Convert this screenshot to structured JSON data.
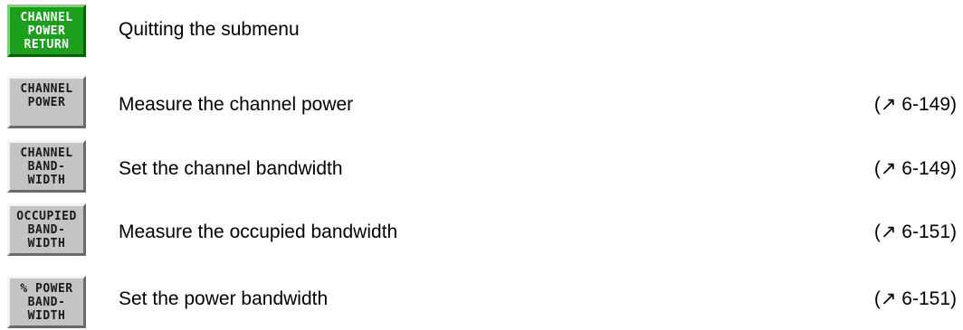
{
  "softkeys": [
    {
      "lines": [
        "CHANNEL",
        "POWER",
        "RETURN"
      ],
      "style": "green",
      "description": "Quitting the submenu",
      "reference": ""
    },
    {
      "lines": [
        "CHANNEL",
        "POWER",
        ""
      ],
      "style": "grey",
      "description": "Measure the channel power",
      "reference": "(↗ 6-149)"
    },
    {
      "lines": [
        "CHANNEL",
        "BAND-",
        "WIDTH"
      ],
      "style": "grey",
      "description": "Set the channel bandwidth",
      "reference": "(↗ 6-149)"
    },
    {
      "lines": [
        "OCCUPIED",
        "BAND-",
        "WIDTH"
      ],
      "style": "grey",
      "description": "Measure the occupied bandwidth",
      "reference": "(↗ 6-151)"
    },
    {
      "lines": [
        "% POWER",
        "BAND-",
        "WIDTH"
      ],
      "style": "grey",
      "description": "Set the power bandwidth",
      "reference": "(↗ 6-151)"
    }
  ],
  "colors": {
    "return_key": "#1e9e1e",
    "softkey": "#c4c4c4",
    "text": "#000000"
  }
}
